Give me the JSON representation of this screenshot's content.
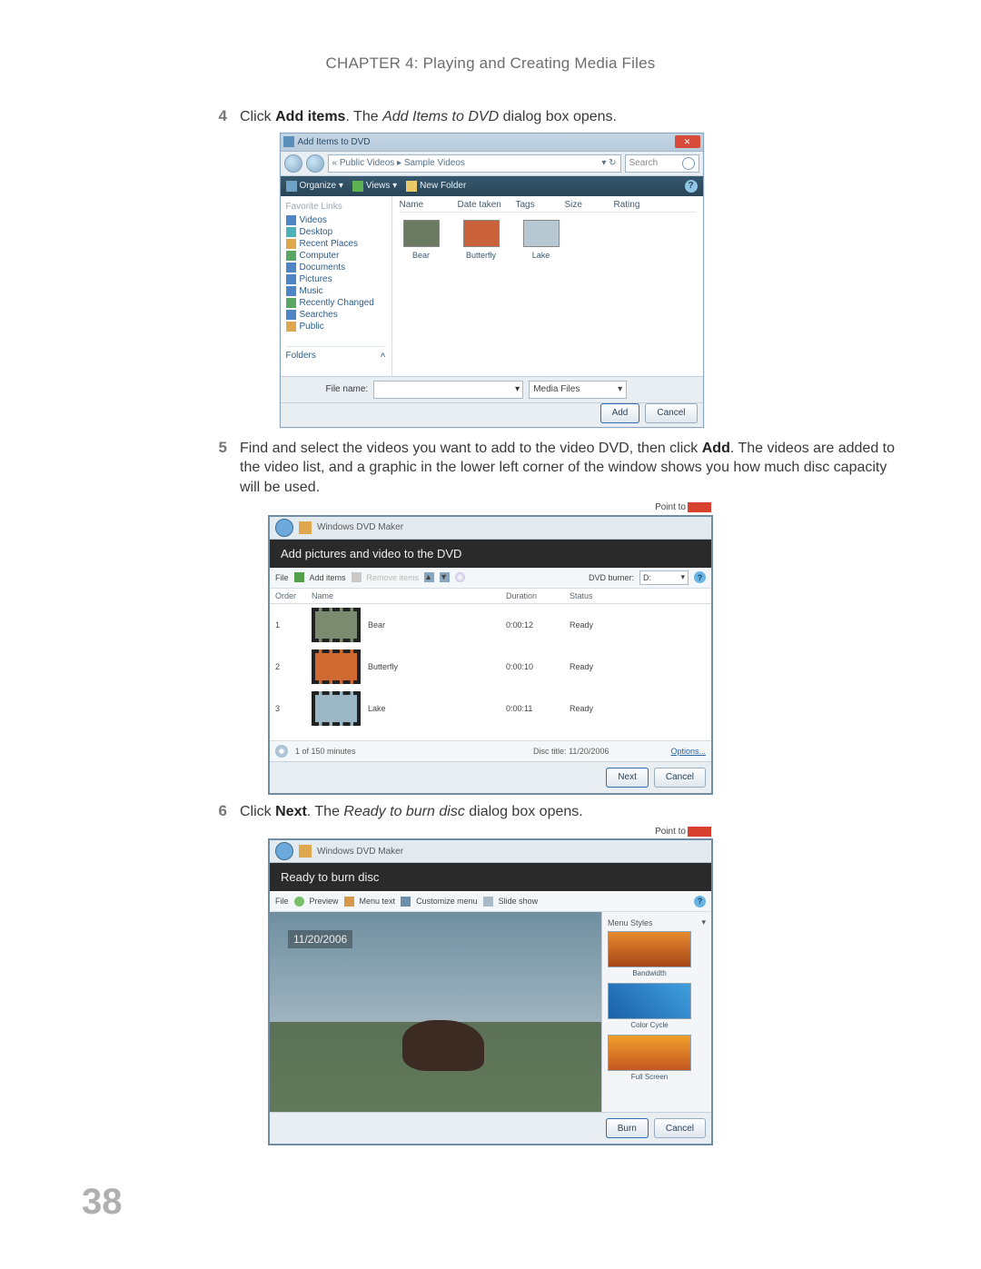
{
  "chapter_header": "CHAPTER 4: Playing and Creating Media Files",
  "page_number": "38",
  "steps": {
    "s4": {
      "num": "4",
      "prefix": "Click ",
      "bold": "Add items",
      "mid": ". The ",
      "italic": "Add Items to DVD",
      "suffix": " dialog box opens."
    },
    "s5": {
      "num": "5",
      "text_a": "Find and select the videos you want to add to the video DVD, then click ",
      "bold": "Add",
      "text_b": ". The videos are added to the video list, and a graphic in the lower left corner of the window shows you how much disc capacity will be used."
    },
    "s6": {
      "num": "6",
      "prefix": "Click ",
      "bold": "Next",
      "mid": ". The ",
      "italic": "Ready to burn disc",
      "suffix": " dialog box opens."
    }
  },
  "fig1": {
    "title": "Add Items to DVD",
    "path": "« Public Videos ▸ Sample Videos",
    "search_placeholder": "Search",
    "toolbar": {
      "organize": "Organize ▾",
      "views": "Views ▾",
      "newfolder": "New Folder"
    },
    "fav_header": "Favorite Links",
    "favorites": [
      "Videos",
      "Desktop",
      "Recent Places",
      "Computer",
      "Documents",
      "Pictures",
      "Music",
      "Recently Changed",
      "Searches",
      "Public"
    ],
    "folders_label": "Folders",
    "columns": [
      "Name",
      "Date taken",
      "Tags",
      "Size",
      "Rating"
    ],
    "thumbs": [
      "Bear",
      "Butterfly",
      "Lake"
    ],
    "filename_label": "File name:",
    "filter": "Media Files",
    "add_btn": "Add",
    "cancel_btn": "Cancel"
  },
  "fig2": {
    "app": "Windows DVD Maker",
    "hint": "Point to",
    "band": "Add pictures and video to the DVD",
    "cmds": {
      "file": "File",
      "add": "Add items",
      "remove": "Remove items"
    },
    "dvd_label": "DVD burner:",
    "dvd_sel": "D:",
    "columns": [
      "Order",
      "Name",
      "Duration",
      "Status"
    ],
    "rows": [
      {
        "order": "1",
        "name": "Bear",
        "dur": "0:00:12",
        "status": "Ready"
      },
      {
        "order": "2",
        "name": "Butterfly",
        "dur": "0:00:10",
        "status": "Ready"
      },
      {
        "order": "3",
        "name": "Lake",
        "dur": "0:00:11",
        "status": "Ready"
      }
    ],
    "capacity": "1 of 150 minutes",
    "disctitle_lbl": "Disc title:",
    "disctitle_val": "11/20/2006",
    "options": "Options...",
    "next": "Next",
    "cancel": "Cancel"
  },
  "fig3": {
    "app": "Windows DVD Maker",
    "hint": "Point to",
    "band": "Ready to burn disc",
    "cmds": {
      "file": "File",
      "preview": "Preview",
      "menutext": "Menu text",
      "custom": "Customize menu",
      "slideshow": "Slide show"
    },
    "date_overlay": "11/20/2006",
    "menu_styles_lbl": "Menu Styles",
    "styles": [
      "Bandwidth",
      "Color Cycle",
      "Full Screen"
    ],
    "burn": "Burn",
    "cancel": "Cancel"
  }
}
